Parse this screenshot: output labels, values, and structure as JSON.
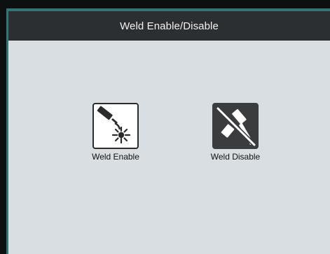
{
  "window": {
    "title": "Weld Enable/Disable"
  },
  "tiles": [
    {
      "label": "Weld Enable",
      "icon": "weld-torch-spark-icon"
    },
    {
      "label": "Weld Disable",
      "icon": "weld-torch-disabled-icon"
    }
  ],
  "colors": {
    "title_bar": "#2c2f31",
    "frame_accent": "#2f7873",
    "content_bg": "#d9dee3",
    "enable_icon_bg": "#ffffff",
    "disable_icon_bg": "#3a3c3e"
  }
}
